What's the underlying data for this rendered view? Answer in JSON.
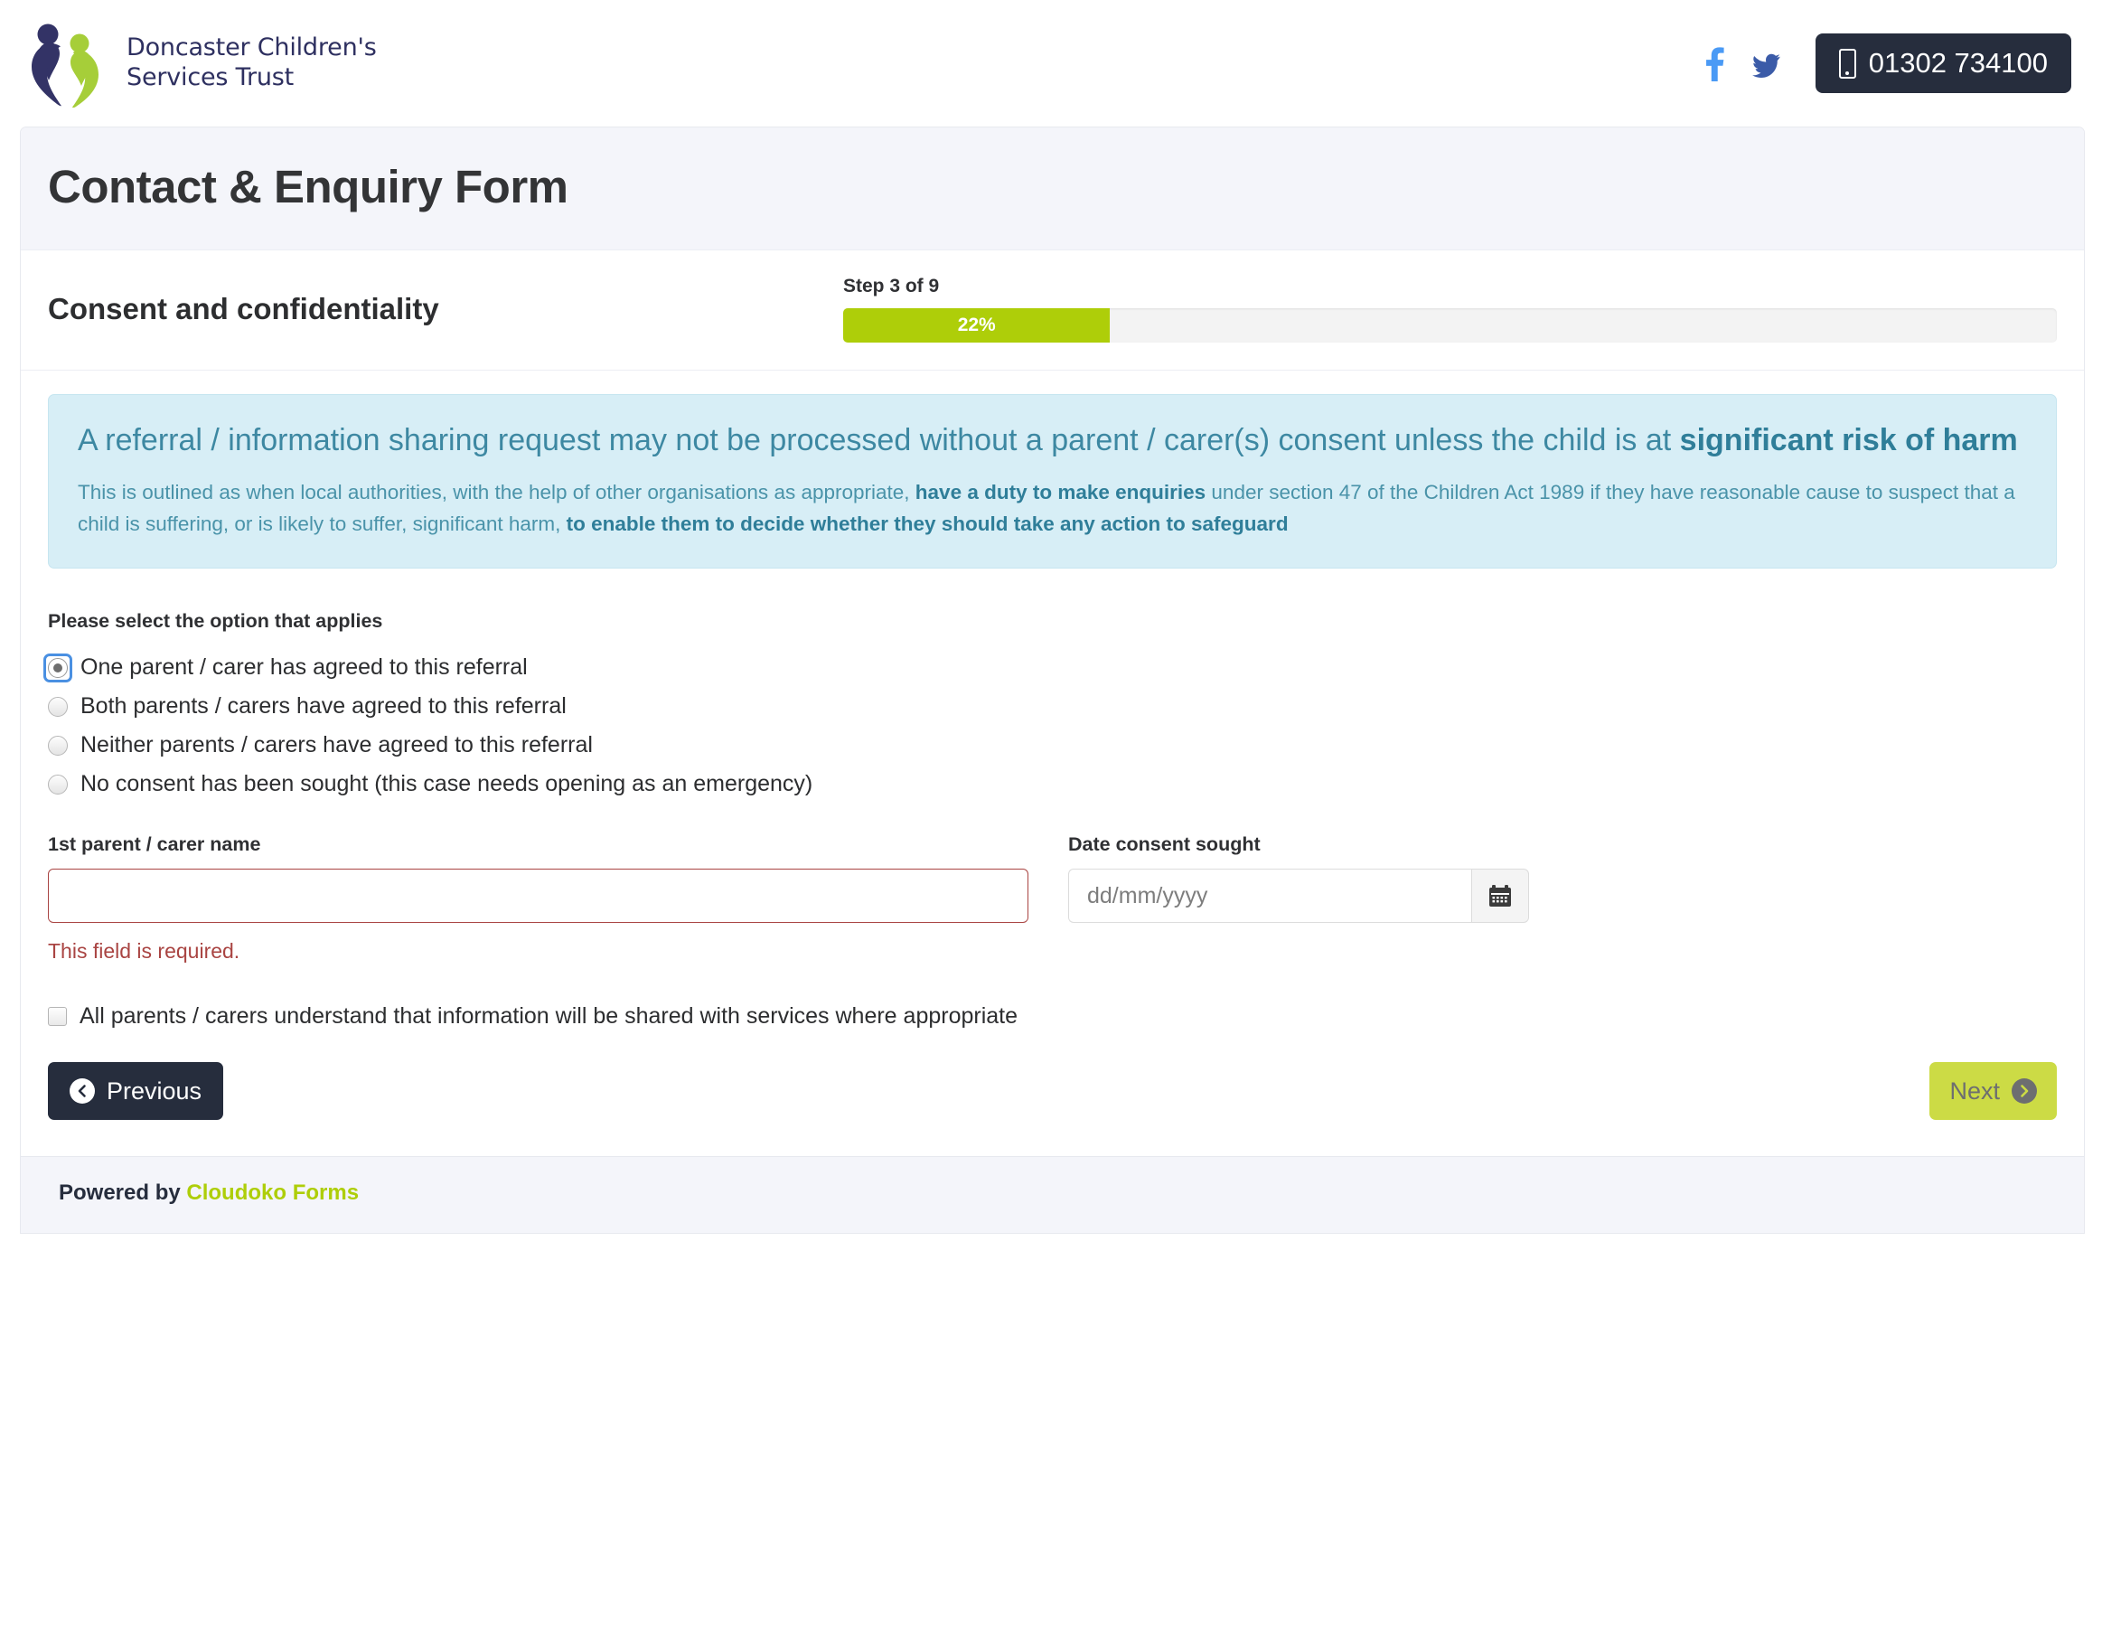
{
  "header": {
    "org_name_line1": "Doncaster Children's",
    "org_name_line2": "Services Trust",
    "logo_icon": "two-figures-heart-logo",
    "facebook_icon": "facebook-icon",
    "twitter_icon": "twitter-icon",
    "phone_icon": "mobile-phone-icon",
    "phone_number": "01302 734100"
  },
  "form": {
    "title": "Contact & Enquiry Form",
    "section_title": "Consent and confidentiality",
    "step_label": "Step 3 of 9",
    "progress_percent": "22%",
    "progress_value": 22
  },
  "alert": {
    "lead_part1": "A referral / information sharing request may not be processed without a parent / carer(s) consent unless the child is at ",
    "lead_bold": "significant risk of harm",
    "body_part1": "This is outlined as when local authorities, with the help of other organisations as appropriate, ",
    "body_bold1": "have a duty to make enquiries",
    "body_part2": " under section 47 of the Children Act 1989 if they have reasonable cause to suspect that a child is suffering, or is likely to suffer, significant harm, ",
    "body_bold2": "to enable them to decide whether they should take any action to safeguard"
  },
  "consent": {
    "legend": "Please select the option that applies",
    "options": [
      {
        "label": "One parent / carer has agreed to this referral",
        "checked": true
      },
      {
        "label": "Both parents / carers have agreed to this referral",
        "checked": false
      },
      {
        "label": "Neither parents / carers have agreed to this referral",
        "checked": false
      },
      {
        "label": "No consent has been sought (this case needs opening as an emergency)",
        "checked": false
      }
    ]
  },
  "fields": {
    "parent_name_label": "1st parent / carer name",
    "parent_name_value": "",
    "parent_name_placeholder": "",
    "parent_name_error": "This field is required.",
    "date_label": "Date consent sought",
    "date_value": "",
    "date_placeholder": "dd/mm/yyyy",
    "calendar_icon": "calendar-icon",
    "understand_checkbox_label": "All parents / carers understand that information will be shared with services where appropriate",
    "understand_checked": false
  },
  "nav": {
    "previous_label": "Previous",
    "previous_icon": "chevron-left-circle-icon",
    "next_label": "Next",
    "next_icon": "chevron-right-circle-icon"
  },
  "footer": {
    "powered_by": "Powered by",
    "brand": "Cloudoko Forms"
  },
  "colors": {
    "brand_navy": "#2e3060",
    "brand_lime": "#aece09",
    "dark_button": "#262d3d",
    "next_button": "#ccdb45",
    "alert_bg": "#d7eef6",
    "alert_text": "#3a87a0",
    "error": "#a94442",
    "facebook": "#4a9af5",
    "twitter": "#3b5ba8"
  }
}
